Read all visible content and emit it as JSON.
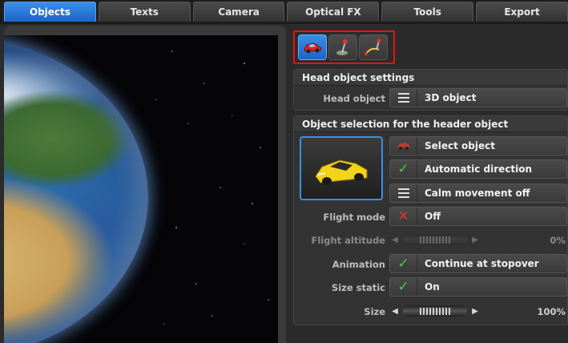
{
  "tabs": [
    {
      "label": "Objects",
      "active": true
    },
    {
      "label": "Texts",
      "active": false
    },
    {
      "label": "Camera",
      "active": false
    },
    {
      "label": "Optical FX",
      "active": false
    },
    {
      "label": "Tools",
      "active": false
    },
    {
      "label": "Export",
      "active": false
    }
  ],
  "toolbar_icons": [
    "car-icon",
    "pin-icon",
    "route-icon"
  ],
  "head_section": {
    "title": "Head object settings",
    "head_object_label": "Head object",
    "head_object_value": "3D object",
    "head_object_icon": "menu-icon"
  },
  "selection_section": {
    "title": "Object selection for the header object",
    "thumbnail_icon": "yellow-car-icon",
    "select_object": "Select object",
    "automatic_direction": "Automatic direction",
    "calm_movement": "Calm movement off",
    "flight_mode_label": "Flight mode",
    "flight_mode_value": "Off",
    "flight_altitude_label": "Flight altitude",
    "flight_altitude_value": "0%",
    "animation_label": "Animation",
    "animation_value": "Continue at stopover",
    "size_static_label": "Size static",
    "size_static_value": "On",
    "size_label": "Size",
    "size_value": "100%"
  },
  "colors": {
    "accent": "#1d63c9",
    "highlight_border": "#e11111",
    "check": "#4cc54a",
    "cross": "#d83a2e"
  }
}
